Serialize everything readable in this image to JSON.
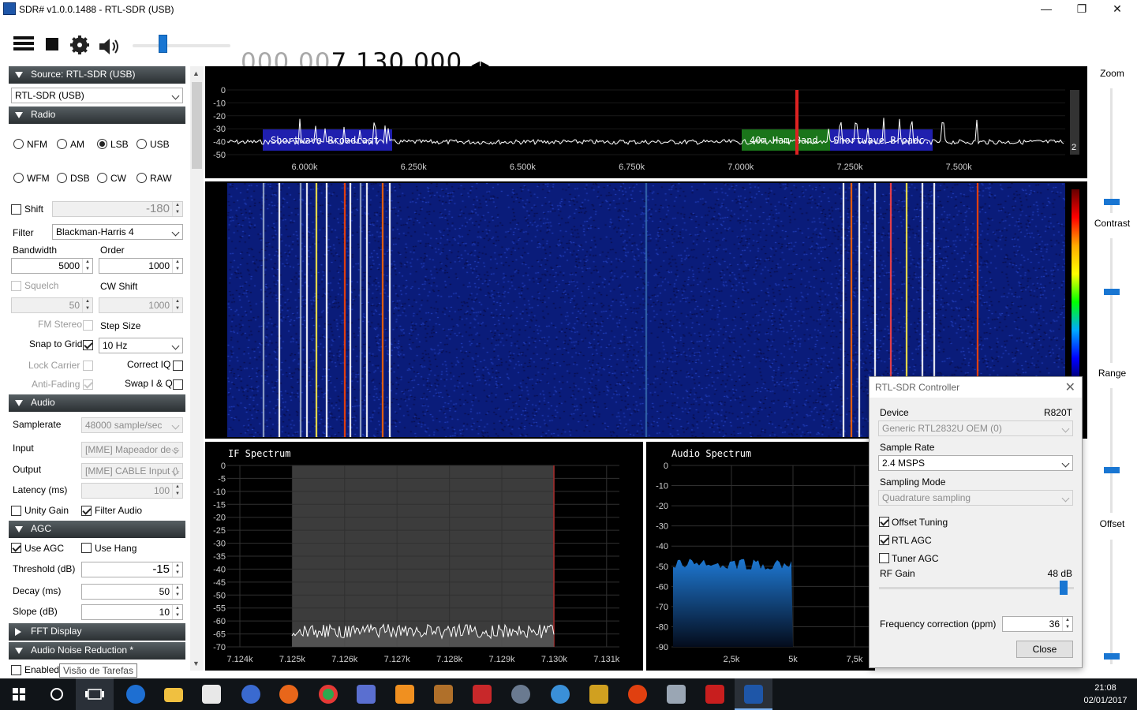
{
  "window": {
    "title": "SDR# v1.0.0.1488 - RTL-SDR (USB)",
    "minimize": "—",
    "maximize": "❐",
    "close": "✕"
  },
  "toolbar": {
    "freq_dim": "000.00",
    "freq_active": "7.130.000",
    "freq_arrows": "◂▸",
    "volume": 0.3
  },
  "source": {
    "header": "Source: RTL-SDR (USB)",
    "device": "RTL-SDR (USB)"
  },
  "radio": {
    "header": "Radio",
    "modes_row1": [
      "NFM",
      "AM",
      "LSB",
      "USB"
    ],
    "modes_row2": [
      "WFM",
      "DSB",
      "CW",
      "RAW"
    ],
    "selected_mode": "LSB",
    "shift_label": "Shift",
    "shift_value": "-180",
    "filter_label": "Filter",
    "filter_value": "Blackman-Harris 4",
    "bandwidth_label": "Bandwidth",
    "bandwidth_value": "5000",
    "order_label": "Order",
    "order_value": "1000",
    "squelch_label": "Squelch",
    "squelch_value": "50",
    "cwshift_label": "CW Shift",
    "cwshift_value": "1000",
    "fmstereo_label": "FM Stereo",
    "stepsize_label": "Step Size",
    "snap_label": "Snap to Grid",
    "step_value": "10 Hz",
    "lockcarrier_label": "Lock Carrier",
    "correctiq_label": "Correct IQ",
    "antifading_label": "Anti-Fading",
    "swapiq_label": "Swap I & Q"
  },
  "audio": {
    "header": "Audio",
    "samplerate_label": "Samplerate",
    "samplerate_value": "48000 sample/sec",
    "input_label": "Input",
    "input_value": "[MME] Mapeador de s",
    "output_label": "Output",
    "output_value": "[MME] CABLE Input (\\",
    "latency_label": "Latency (ms)",
    "latency_value": "100",
    "unity_label": "Unity Gain",
    "filteraudio_label": "Filter Audio"
  },
  "agc": {
    "header": "AGC",
    "useagc_label": "Use AGC",
    "usehang_label": "Use Hang",
    "threshold_label": "Threshold (dB)",
    "threshold_value": "-15",
    "decay_label": "Decay (ms)",
    "decay_value": "50",
    "slope_label": "Slope (dB)",
    "slope_value": "10"
  },
  "fft": {
    "header": "FFT Display"
  },
  "noise": {
    "header": "Audio Noise Reduction *",
    "enabled_label": "Enabled"
  },
  "tooltip": "Visão de Tarefas",
  "spectrum": {
    "y_ticks": [
      "0",
      "-10",
      "-20",
      "-30",
      "-40",
      "-50"
    ],
    "x_ticks": [
      "6.000k",
      "6.250k",
      "6.500k",
      "6.750k",
      "7.000k",
      "7.250k",
      "7.500k"
    ],
    "bands": [
      "Shortwave Broadcast",
      "40m Ham Band",
      "Shortwave Broadc."
    ],
    "scroll_value": "2"
  },
  "if_spectrum": {
    "title": "IF Spectrum",
    "y_ticks": [
      "0",
      "-5",
      "-10",
      "-15",
      "-20",
      "-25",
      "-30",
      "-35",
      "-40",
      "-45",
      "-50",
      "-55",
      "-60",
      "-65",
      "-70"
    ],
    "x_ticks": [
      "7.124k",
      "7.125k",
      "7.126k",
      "7.127k",
      "7.128k",
      "7.129k",
      "7.130k",
      "7.131k"
    ]
  },
  "audio_spectrum": {
    "title": "Audio Spectrum",
    "y_ticks": [
      "0",
      "-10",
      "-20",
      "-30",
      "-40",
      "-50",
      "-60",
      "-70",
      "-80",
      "-90"
    ],
    "x_ticks": [
      "2,5k",
      "5k",
      "7,5k"
    ]
  },
  "right": {
    "zoom": "Zoom",
    "contrast": "Contrast",
    "range": "Range",
    "offset": "Offset"
  },
  "rtl": {
    "title": "RTL-SDR Controller",
    "device_label": "Device",
    "device_tuner": "R820T",
    "device_value": "Generic RTL2832U OEM (0)",
    "samplerate_label": "Sample Rate",
    "samplerate_value": "2.4 MSPS",
    "mode_label": "Sampling Mode",
    "mode_value": "Quadrature sampling",
    "offset_label": "Offset Tuning",
    "rtlagc_label": "RTL AGC",
    "tuneragc_label": "Tuner AGC",
    "rfgain_label": "RF Gain",
    "rfgain_value": "48 dB",
    "freqcorr_label": "Frequency correction (ppm)",
    "freqcorr_value": "36",
    "close_label": "Close"
  },
  "clock": {
    "time": "21:08",
    "date": "02/01/2017"
  }
}
